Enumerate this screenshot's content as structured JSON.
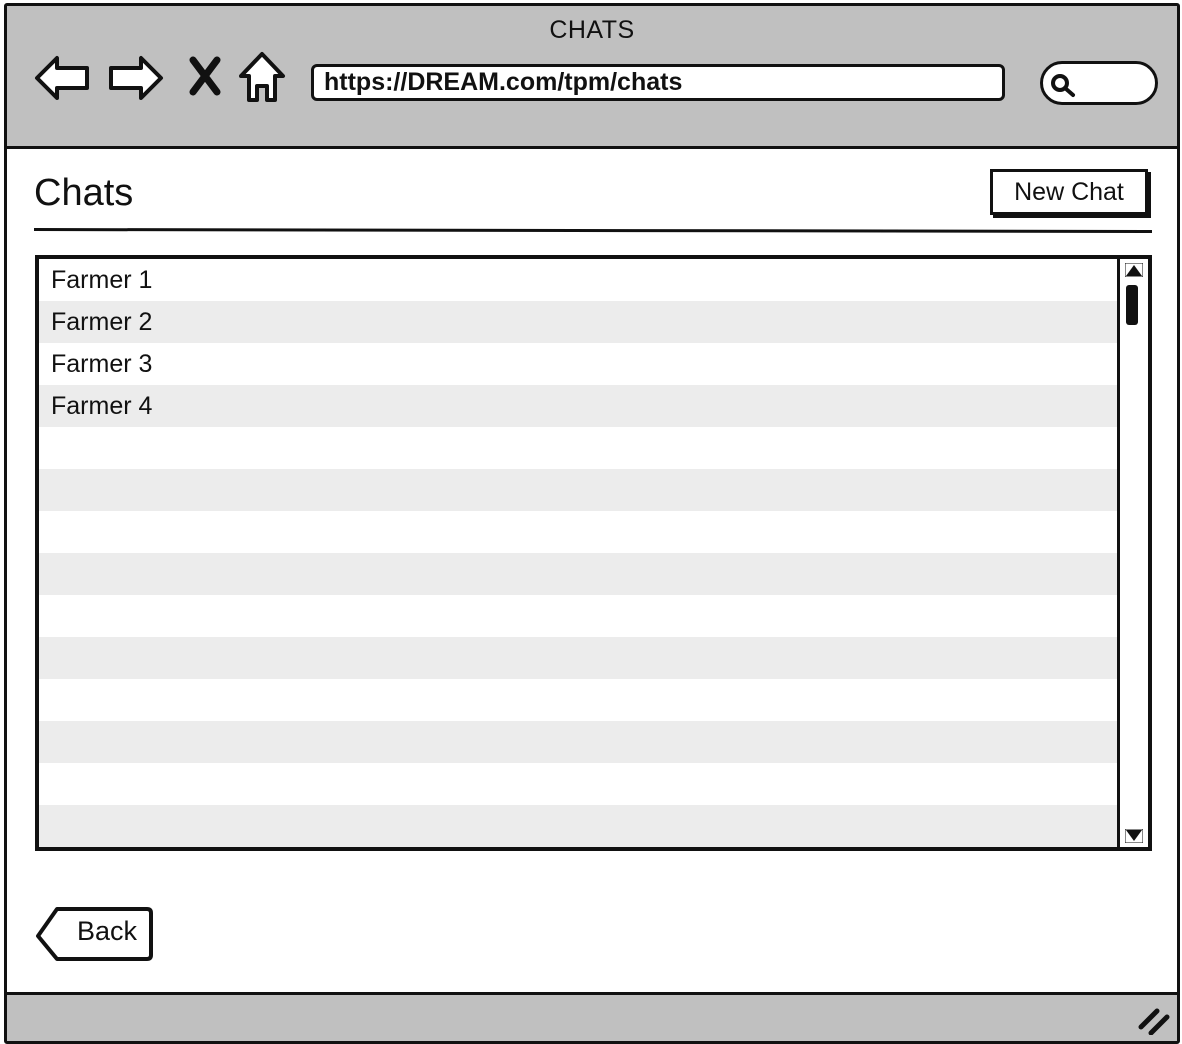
{
  "window": {
    "title": "CHATS"
  },
  "browser": {
    "url": "https://DREAM.com/tpm/chats",
    "nav_icons": [
      "back-arrow-icon",
      "forward-arrow-icon",
      "close-icon",
      "home-icon"
    ],
    "search_icon": "search-icon"
  },
  "page": {
    "title": "Chats",
    "new_chat_label": "New Chat",
    "back_label": "Back"
  },
  "chat_list": {
    "items": [
      "Farmer 1",
      "Farmer 2",
      "Farmer 3",
      "Farmer 4",
      "",
      "",
      "",
      "",
      "",
      "",
      "",
      "",
      "",
      ""
    ]
  },
  "colors": {
    "chrome": "#c0c0c0",
    "stripe": "#ececec",
    "ink": "#111111"
  }
}
